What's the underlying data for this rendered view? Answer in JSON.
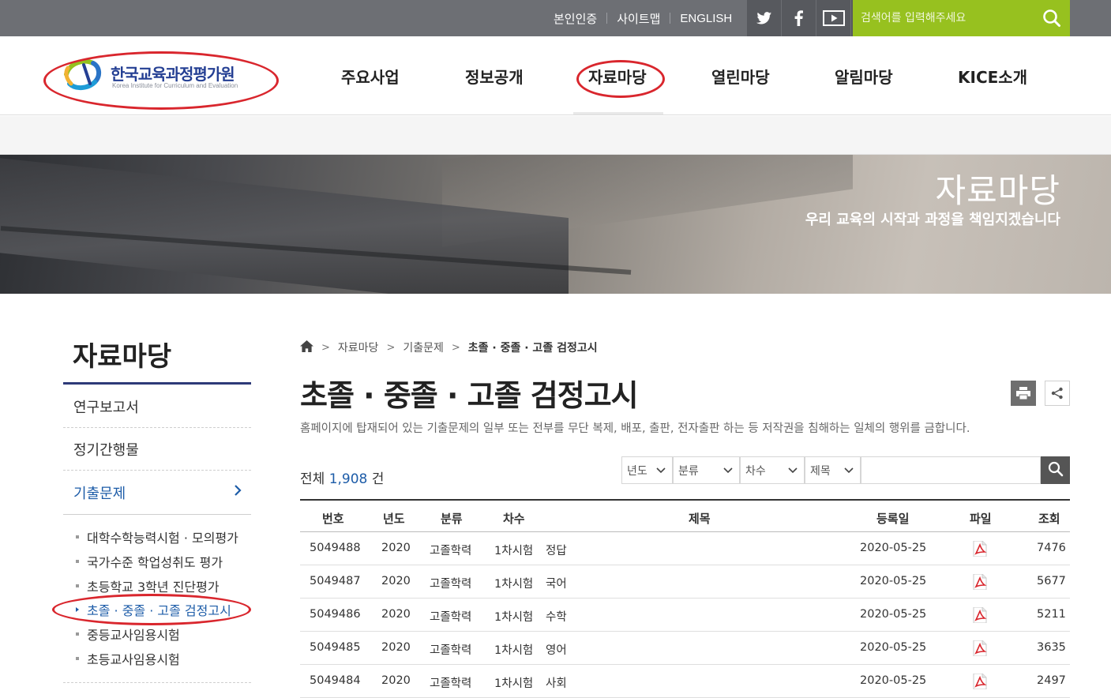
{
  "util": {
    "auth": "본인인증",
    "sitemap": "사이트맵",
    "english": "ENGLISH"
  },
  "search": {
    "placeholder": "검색어를 입력해주세요"
  },
  "logo": {
    "name": "한국교육과정평가원",
    "english": "Korea Institute for Curriculum and Evaluation"
  },
  "gnb": [
    "주요사업",
    "정보공개",
    "자료마당",
    "열린마당",
    "알림마당",
    "KICE소개"
  ],
  "hero": {
    "title": "자료마당",
    "subtitle": "우리 교육의 시작과 과정을 책임지겠습니다"
  },
  "lnb": {
    "title": "자료마당",
    "items": [
      "연구보고서",
      "정기간행물",
      "기출문제"
    ],
    "sub_items": [
      "대학수학능력시험 · 모의평가",
      "국가수준 학업성취도 평가",
      "초등학교 3학년 진단평가",
      "초졸 · 중졸 · 고졸 검정고시",
      "중등교사임용시험",
      "초등교사임용시험"
    ]
  },
  "breadcrumb": [
    "자료마당",
    "기출문제",
    "초졸 · 중졸 · 고졸 검정고시"
  ],
  "page": {
    "title": "초졸 · 중졸 · 고졸 검정고시",
    "notice": "홈페이지에 탑재되어 있는 기출문제의 일부 또는 전부를 무단 복제, 배포, 출판, 전자출판 하는 등 저작권을 침해하는 일체의 행위를 금합니다.",
    "total_prefix": "전체",
    "total_count": "1,908",
    "total_suffix": "건"
  },
  "filters": [
    "년도",
    "분류",
    "차수",
    "제목"
  ],
  "table": {
    "headers": [
      "번호",
      "년도",
      "분류",
      "차수",
      "제목",
      "등록일",
      "파일",
      "조회"
    ],
    "rows": [
      {
        "no": "5049488",
        "year": "2020",
        "category": "고졸학력",
        "round": "1차시험",
        "title": "정답",
        "date": "2020-05-25",
        "views": "7476"
      },
      {
        "no": "5049487",
        "year": "2020",
        "category": "고졸학력",
        "round": "1차시험",
        "title": "국어",
        "date": "2020-05-25",
        "views": "5677"
      },
      {
        "no": "5049486",
        "year": "2020",
        "category": "고졸학력",
        "round": "1차시험",
        "title": "수학",
        "date": "2020-05-25",
        "views": "5211"
      },
      {
        "no": "5049485",
        "year": "2020",
        "category": "고졸학력",
        "round": "1차시험",
        "title": "영어",
        "date": "2020-05-25",
        "views": "3635"
      },
      {
        "no": "5049484",
        "year": "2020",
        "category": "고졸학력",
        "round": "1차시험",
        "title": "사회",
        "date": "2020-05-25",
        "views": "2497"
      }
    ]
  },
  "icons": [
    "twitter-icon",
    "facebook-icon",
    "youtube-icon",
    "search-icon",
    "home-icon",
    "print-icon",
    "share-icon",
    "pdf-icon",
    "chevron-right-icon"
  ],
  "colors": {
    "accent": "#1d5ca8",
    "search_bar": "#97c11f",
    "highlight_ring": "#d9262d"
  }
}
